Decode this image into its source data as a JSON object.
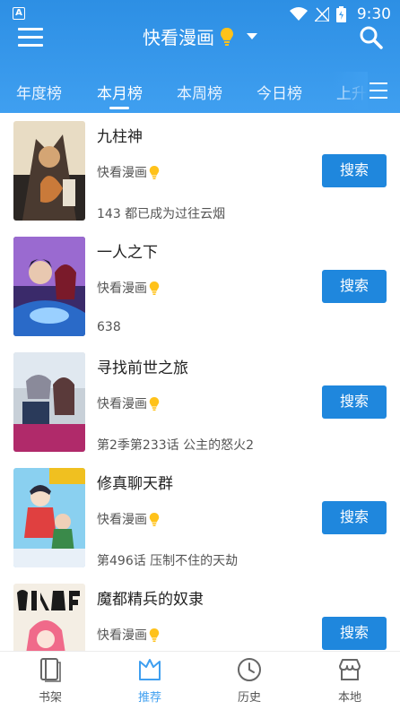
{
  "status_bar": {
    "app_icon": "A",
    "time": "9:30"
  },
  "toolbar": {
    "title": "快看漫画",
    "title_icon": "lightbulb-icon"
  },
  "tabs": [
    {
      "label": "年度榜"
    },
    {
      "label": "本月榜",
      "active": true
    },
    {
      "label": "本周榜"
    },
    {
      "label": "今日榜"
    },
    {
      "label": "上升"
    }
  ],
  "list": {
    "items": [
      {
        "title": "九柱神",
        "source": "快看漫画",
        "subtitle": "143 都已成为过往云烟",
        "button": "搜索"
      },
      {
        "title": "一人之下",
        "source": "快看漫画",
        "subtitle": "638",
        "button": "搜索"
      },
      {
        "title": "寻找前世之旅",
        "source": "快看漫画",
        "subtitle": "第2季第233话 公主的怒火2",
        "button": "搜索"
      },
      {
        "title": "修真聊天群",
        "source": "快看漫画",
        "subtitle": "第496话 压制不住的天劫",
        "button": "搜索"
      },
      {
        "title": "魔都精兵的奴隶",
        "source": "快看漫画",
        "subtitle": "",
        "button": "搜索"
      }
    ]
  },
  "bottom_nav": [
    {
      "label": "书架",
      "icon": "bookshelf-icon"
    },
    {
      "label": "推荐",
      "icon": "recommend-icon",
      "active": true
    },
    {
      "label": "历史",
      "icon": "clock-icon"
    },
    {
      "label": "本地",
      "icon": "local-store-icon"
    }
  ],
  "colors": {
    "header": "#3f9ff0",
    "button": "#1f87dd",
    "active_nav": "#3f9ff0"
  }
}
